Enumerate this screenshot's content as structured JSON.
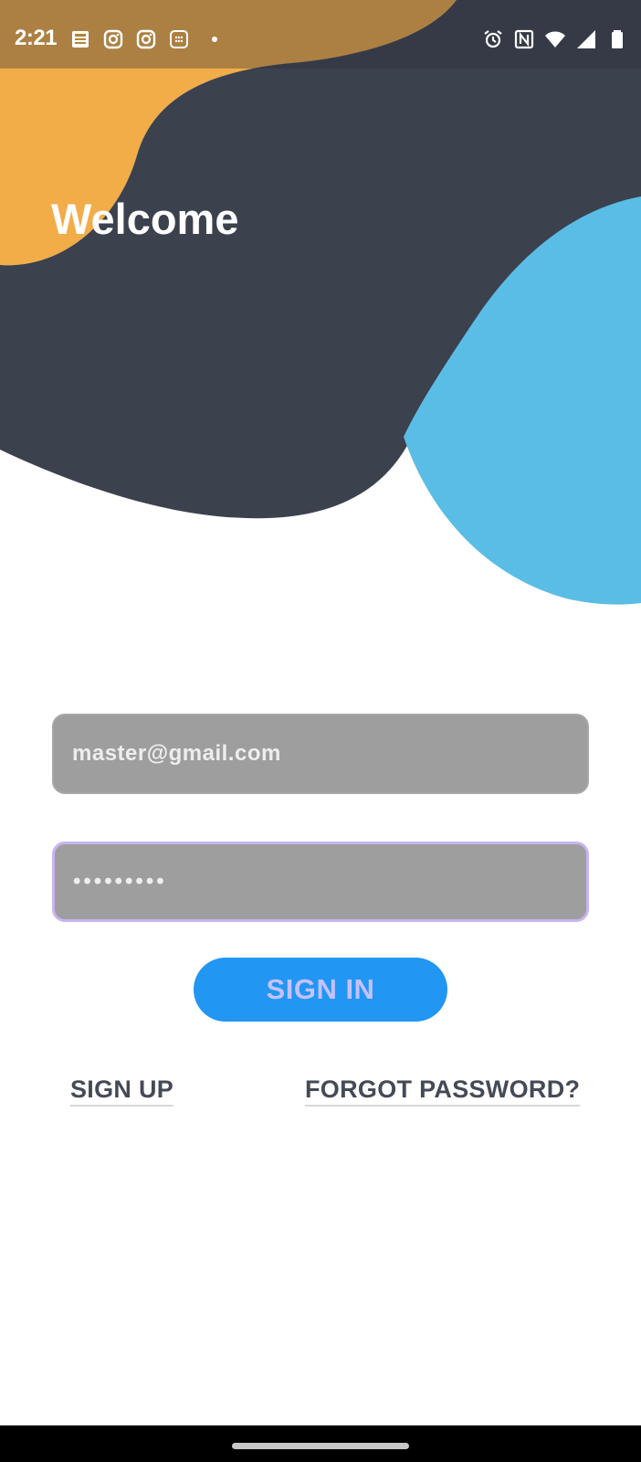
{
  "status_bar": {
    "time": "2:21",
    "left_icons": [
      "news-icon",
      "instagram-icon",
      "instagram-icon",
      "calculator-icon",
      "notification-dot-icon"
    ],
    "right_icons": [
      "alarm-icon",
      "nfc-icon",
      "wifi-icon",
      "signal-icon",
      "battery-icon"
    ]
  },
  "header": {
    "title": "Welcome"
  },
  "form": {
    "email_value": "master@gmail.com",
    "password_value": "•••••••••",
    "signin_label": "SIGN IN"
  },
  "links": {
    "signup_label": "SIGN UP",
    "forgot_label": "FORGOT PASSWORD?"
  },
  "colors": {
    "orange_blob": "#F2AC48",
    "dark_blob": "#3B414D",
    "blue_blob": "#5ABDE6",
    "input_bg": "#9E9E9E",
    "button_bg": "#2196F3",
    "button_text": "#C5C1FF",
    "link_text": "#454A57"
  }
}
